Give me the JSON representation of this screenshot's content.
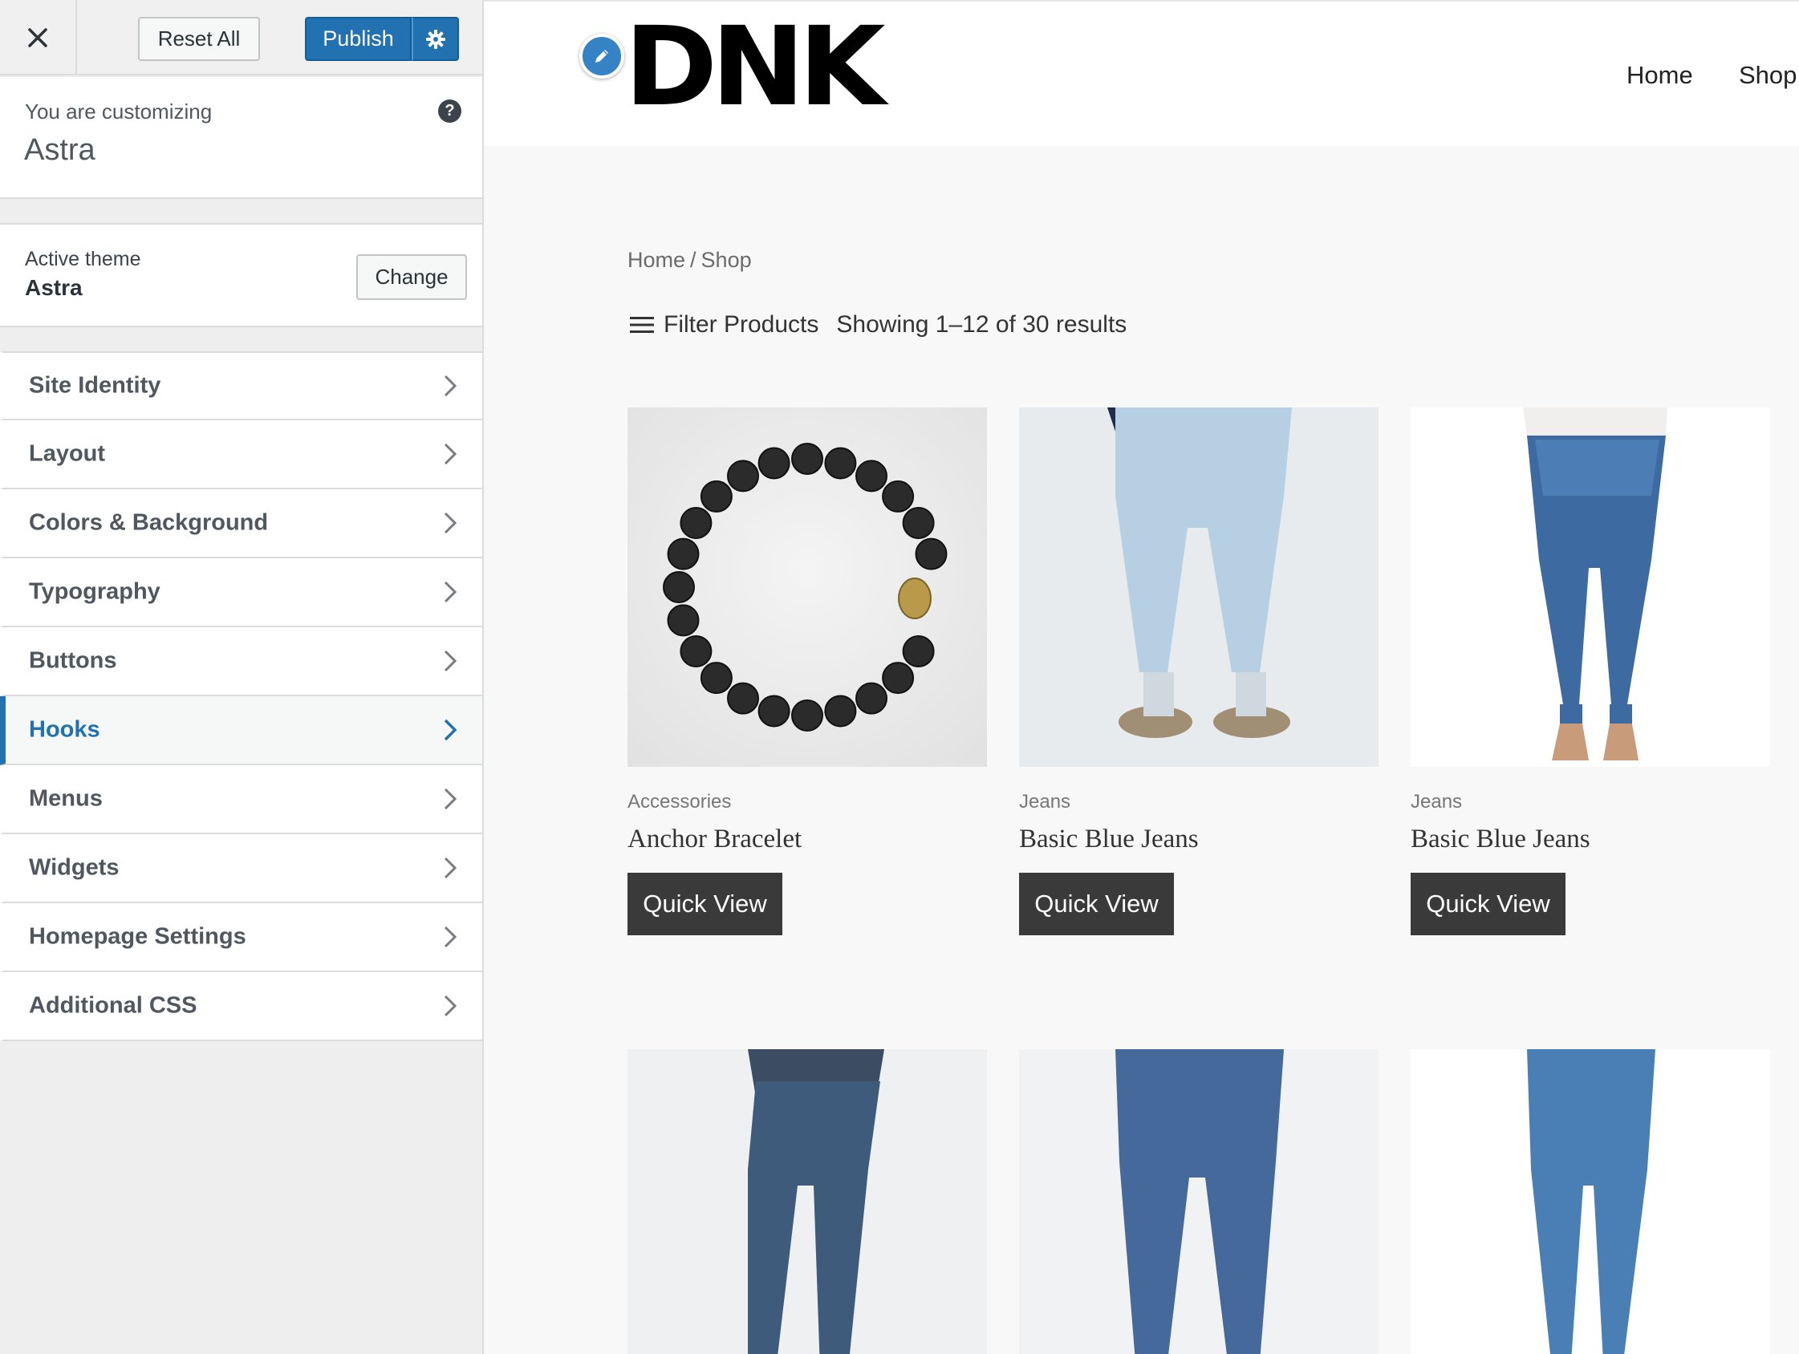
{
  "customizer": {
    "topbar": {
      "close_label": "×",
      "reset_label": "Reset All",
      "publish_label": "Publish"
    },
    "customizing": {
      "label": "You are customizing",
      "theme": "Astra"
    },
    "theme_panel": {
      "label": "Active theme",
      "name": "Astra",
      "change_label": "Change"
    },
    "menu": [
      {
        "label": "Site Identity",
        "active": false
      },
      {
        "label": "Layout",
        "active": false
      },
      {
        "label": "Colors & Background",
        "active": false
      },
      {
        "label": "Typography",
        "active": false
      },
      {
        "label": "Buttons",
        "active": false
      },
      {
        "label": "Hooks",
        "active": true
      },
      {
        "label": "Menus",
        "active": false
      },
      {
        "label": "Widgets",
        "active": false
      },
      {
        "label": "Homepage Settings",
        "active": false
      },
      {
        "label": "Additional CSS",
        "active": false
      }
    ],
    "accent_color": "#2271b1"
  },
  "site": {
    "logo": "DNK",
    "nav": [
      "Home",
      "Shop"
    ],
    "breadcrumb": {
      "home": "Home",
      "sep": "/",
      "current": "Shop"
    },
    "filter_label": "Filter Products",
    "result_count": "Showing 1–12 of 30 results",
    "products": [
      {
        "category": "Accessories",
        "title": "Anchor Bracelet",
        "button": "Quick View",
        "image": "bracelet"
      },
      {
        "category": "Jeans",
        "title": "Basic Blue Jeans",
        "button": "Quick View",
        "image": "light-jeans"
      },
      {
        "category": "Jeans",
        "title": "Basic Blue Jeans",
        "button": "Quick View",
        "image": "skinny-jeans"
      },
      {
        "category": "",
        "title": "",
        "button": "",
        "image": "dark-jeans-sneakers"
      },
      {
        "category": "",
        "title": "",
        "button": "",
        "image": "blue-jeans-sneakers"
      },
      {
        "category": "",
        "title": "",
        "button": "",
        "image": "blue-jeans-white-shoes"
      }
    ]
  }
}
